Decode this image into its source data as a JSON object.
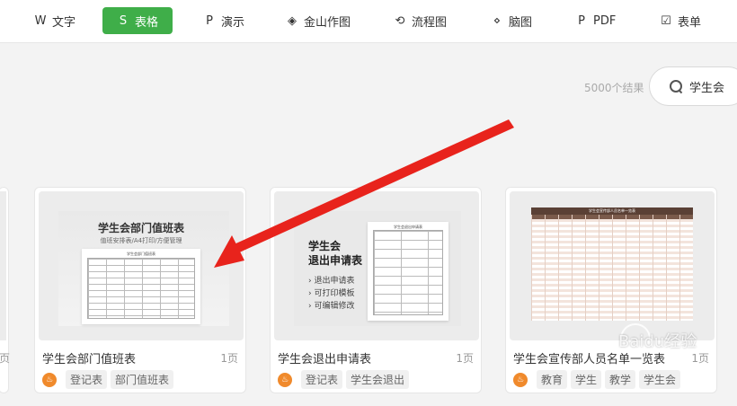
{
  "nav": {
    "items": [
      {
        "icon": "W",
        "label": "文字"
      },
      {
        "icon": "S",
        "label": "表格"
      },
      {
        "icon": "P",
        "label": "演示"
      },
      {
        "icon": "◈",
        "label": "金山作图"
      },
      {
        "icon": "⟲",
        "label": "流程图"
      },
      {
        "icon": "⋄",
        "label": "脑图"
      },
      {
        "icon": "P",
        "label": "PDF"
      },
      {
        "icon": "☑",
        "label": "表单"
      }
    ],
    "active_index": 1,
    "active_color": "#3fae49"
  },
  "search": {
    "result_count": "5000个结果",
    "query": "学生会"
  },
  "edge_card": {
    "pages": "页"
  },
  "cards": [
    {
      "title": "学生会部门值班表",
      "pages": "1页",
      "badge_icon": "orange-flame",
      "tags": [
        "登记表",
        "部门值班表"
      ],
      "thumb": {
        "heading": "学生会部门值班表",
        "sub": "值班安排表/A4打印/方便管理",
        "paper_title": "学生会部门值班表"
      }
    },
    {
      "title": "学生会退出申请表",
      "pages": "1页",
      "badge_icon": "orange-flame",
      "tags": [
        "登记表",
        "学生会退出"
      ],
      "thumb": {
        "heading1": "学生会",
        "heading2": "退出申请表",
        "bullets": [
          "退出申请表",
          "可打印模板",
          "可编辑修改"
        ],
        "paper_title": "学生会退出申请表"
      }
    },
    {
      "title": "学生会宣传部人员名单一览表",
      "pages": "1页",
      "badge_icon": "orange-flame",
      "tags": [
        "教育",
        "学生",
        "教学",
        "学生会"
      ],
      "thumb": {
        "sheet_title": "学生会宣传部人员名单一览表"
      }
    }
  ],
  "watermark": "Baidu经验",
  "colors": {
    "accent": "#3fae49",
    "arrow": "#e8231c",
    "badge": "#f08a2c"
  }
}
